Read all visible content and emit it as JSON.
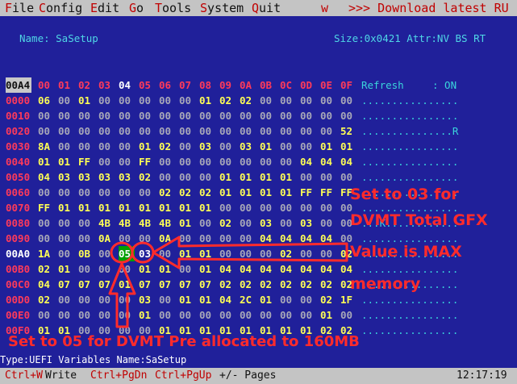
{
  "menubar": {
    "items": [
      {
        "hotkey": "F",
        "rest": "ile"
      },
      {
        "hotkey": "C",
        "rest": "onfig"
      },
      {
        "hotkey": "E",
        "rest": "dit"
      },
      {
        "hotkey": "G",
        "rest": "o"
      },
      {
        "hotkey": "T",
        "rest": "ools"
      },
      {
        "hotkey": "S",
        "rest": "ystem"
      },
      {
        "hotkey": "Q",
        "rest": "uit"
      }
    ],
    "marker": "w",
    "marquee": ">>> Download latest RU fro"
  },
  "header": {
    "name_label": "Name: SaSetup",
    "info": "Size:0x0421 Attr:NV BS RT"
  },
  "hex": {
    "corner": "00A4",
    "columns": [
      "00",
      "01",
      "02",
      "03",
      "04",
      "05",
      "06",
      "07",
      "08",
      "09",
      "0A",
      "0B",
      "0C",
      "0D",
      "0E",
      "0F"
    ],
    "rows": [
      {
        "addr": "0000",
        "bytes": [
          "06",
          "00",
          "01",
          "00",
          "00",
          "00",
          "00",
          "00",
          "01",
          "02",
          "02",
          "00",
          "00",
          "00",
          "00",
          "00"
        ]
      },
      {
        "addr": "0010",
        "bytes": [
          "00",
          "00",
          "00",
          "00",
          "00",
          "00",
          "00",
          "00",
          "00",
          "00",
          "00",
          "00",
          "00",
          "00",
          "00",
          "00"
        ]
      },
      {
        "addr": "0020",
        "bytes": [
          "00",
          "00",
          "00",
          "00",
          "00",
          "00",
          "00",
          "00",
          "00",
          "00",
          "00",
          "00",
          "00",
          "00",
          "00",
          "52"
        ]
      },
      {
        "addr": "0030",
        "bytes": [
          "8A",
          "00",
          "00",
          "00",
          "00",
          "01",
          "02",
          "00",
          "03",
          "00",
          "03",
          "01",
          "00",
          "00",
          "01",
          "01"
        ]
      },
      {
        "addr": "0040",
        "bytes": [
          "01",
          "01",
          "FF",
          "00",
          "00",
          "FF",
          "00",
          "00",
          "00",
          "00",
          "00",
          "00",
          "00",
          "04",
          "04",
          "04"
        ]
      },
      {
        "addr": "0050",
        "bytes": [
          "04",
          "03",
          "03",
          "03",
          "03",
          "02",
          "00",
          "00",
          "00",
          "01",
          "01",
          "01",
          "01",
          "00",
          "00",
          "00"
        ]
      },
      {
        "addr": "0060",
        "bytes": [
          "00",
          "00",
          "00",
          "00",
          "00",
          "00",
          "02",
          "02",
          "02",
          "01",
          "01",
          "01",
          "01",
          "FF",
          "FF",
          "FF"
        ]
      },
      {
        "addr": "0070",
        "bytes": [
          "FF",
          "01",
          "01",
          "01",
          "01",
          "01",
          "01",
          "01",
          "01",
          "00",
          "00",
          "00",
          "00",
          "00",
          "00",
          "00"
        ]
      },
      {
        "addr": "0080",
        "bytes": [
          "00",
          "00",
          "00",
          "4B",
          "4B",
          "4B",
          "4B",
          "01",
          "00",
          "02",
          "00",
          "03",
          "00",
          "03",
          "00",
          "00"
        ]
      },
      {
        "addr": "0090",
        "bytes": [
          "00",
          "00",
          "00",
          "0A",
          "00",
          "00",
          "0A",
          "00",
          "00",
          "00",
          "00",
          "04",
          "04",
          "04",
          "04",
          "00"
        ]
      },
      {
        "addr": "00A0",
        "bytes": [
          "1A",
          "00",
          "0B",
          "00",
          "05",
          "03",
          "00",
          "01",
          "01",
          "00",
          "00",
          "00",
          "02",
          "00",
          "00",
          "02"
        ]
      },
      {
        "addr": "00B0",
        "bytes": [
          "02",
          "01",
          "00",
          "00",
          "00",
          "01",
          "01",
          "00",
          "01",
          "04",
          "04",
          "04",
          "04",
          "04",
          "04",
          "04"
        ]
      },
      {
        "addr": "00C0",
        "bytes": [
          "04",
          "07",
          "07",
          "07",
          "01",
          "07",
          "07",
          "07",
          "07",
          "02",
          "02",
          "02",
          "02",
          "02",
          "02",
          "02"
        ]
      },
      {
        "addr": "00D0",
        "bytes": [
          "02",
          "00",
          "00",
          "00",
          "00",
          "03",
          "00",
          "01",
          "01",
          "04",
          "2C",
          "01",
          "00",
          "00",
          "02",
          "1F"
        ]
      },
      {
        "addr": "00E0",
        "bytes": [
          "00",
          "00",
          "00",
          "00",
          "00",
          "01",
          "00",
          "00",
          "00",
          "00",
          "00",
          "00",
          "00",
          "00",
          "01",
          "00"
        ]
      },
      {
        "addr": "00F0",
        "bytes": [
          "01",
          "01",
          "00",
          "00",
          "00",
          "00",
          "01",
          "01",
          "01",
          "01",
          "01",
          "01",
          "01",
          "01",
          "02",
          "02"
        ]
      }
    ]
  },
  "side": {
    "refresh_label": "Refresh",
    "refresh_value": ": ON",
    "lines": [
      "................",
      "................",
      "...............R",
      "................",
      "................",
      "................",
      "................",
      "................",
      "...K............",
      "................",
      "................",
      "................",
      "................",
      "................",
      "................",
      "................"
    ]
  },
  "annotations": {
    "line1": "Set to 03 for",
    "line2": "DVMT Total GFX",
    "line3": "Value is MAX",
    "line4": "memory",
    "line5": "Set to 05 for DVMT Pre allocated to 160MB"
  },
  "typebar": {
    "text": "Type:UEFI Variables  Name:SaSetup"
  },
  "statusbar": {
    "key1": "Ctrl+W",
    "action1": "Write",
    "key2": "Ctrl+PgDn",
    "key3": "Ctrl+PgUp",
    "action3": "+/- Pages",
    "clock": "12:17:19"
  },
  "colors": {
    "background": "#20209a",
    "bar": "#c4c4c4",
    "annotation": "#ff2b2b",
    "selected_cell": "#00a000"
  }
}
